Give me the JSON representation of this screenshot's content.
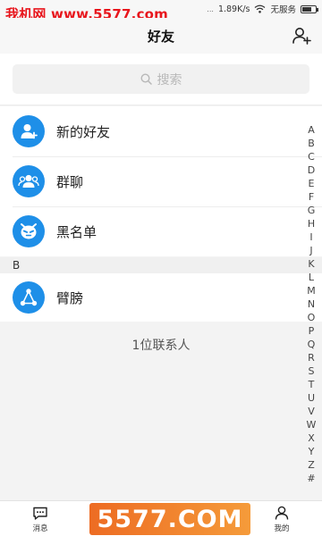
{
  "status_bar": {
    "watermark": "我机网 www.5577.com",
    "dots": "...",
    "speed": "1.89K/s",
    "carrier": "无服务"
  },
  "header": {
    "title": "好友",
    "add_icon": "add-friend-icon"
  },
  "search": {
    "placeholder": "搜索",
    "icon": "search-icon"
  },
  "menu": [
    {
      "label": "新的好友",
      "icon": "new-friend-icon"
    },
    {
      "label": "群聊",
      "icon": "group-chat-icon"
    },
    {
      "label": "黑名单",
      "icon": "blacklist-icon"
    }
  ],
  "section": {
    "letter": "B"
  },
  "contacts": [
    {
      "name": "臂膀",
      "icon": "share-avatar-icon"
    }
  ],
  "contact_count": "1位联系人",
  "index_letters": [
    "A",
    "B",
    "C",
    "D",
    "E",
    "F",
    "G",
    "H",
    "I",
    "J",
    "K",
    "L",
    "M",
    "N",
    "O",
    "P",
    "Q",
    "R",
    "S",
    "T",
    "U",
    "V",
    "W",
    "X",
    "Y",
    "Z",
    "#"
  ],
  "tabs": [
    {
      "label": "消息",
      "icon": "message-icon"
    },
    {
      "label": "",
      "icon": "contacts-icon"
    },
    {
      "label": "",
      "icon": "discover-icon"
    },
    {
      "label": "我的",
      "icon": "profile-icon"
    }
  ],
  "banner": {
    "text": "5577.COM"
  },
  "colors": {
    "accent": "#1e8fe8",
    "watermark": "#e8161d",
    "banner": "#f08a2c"
  }
}
